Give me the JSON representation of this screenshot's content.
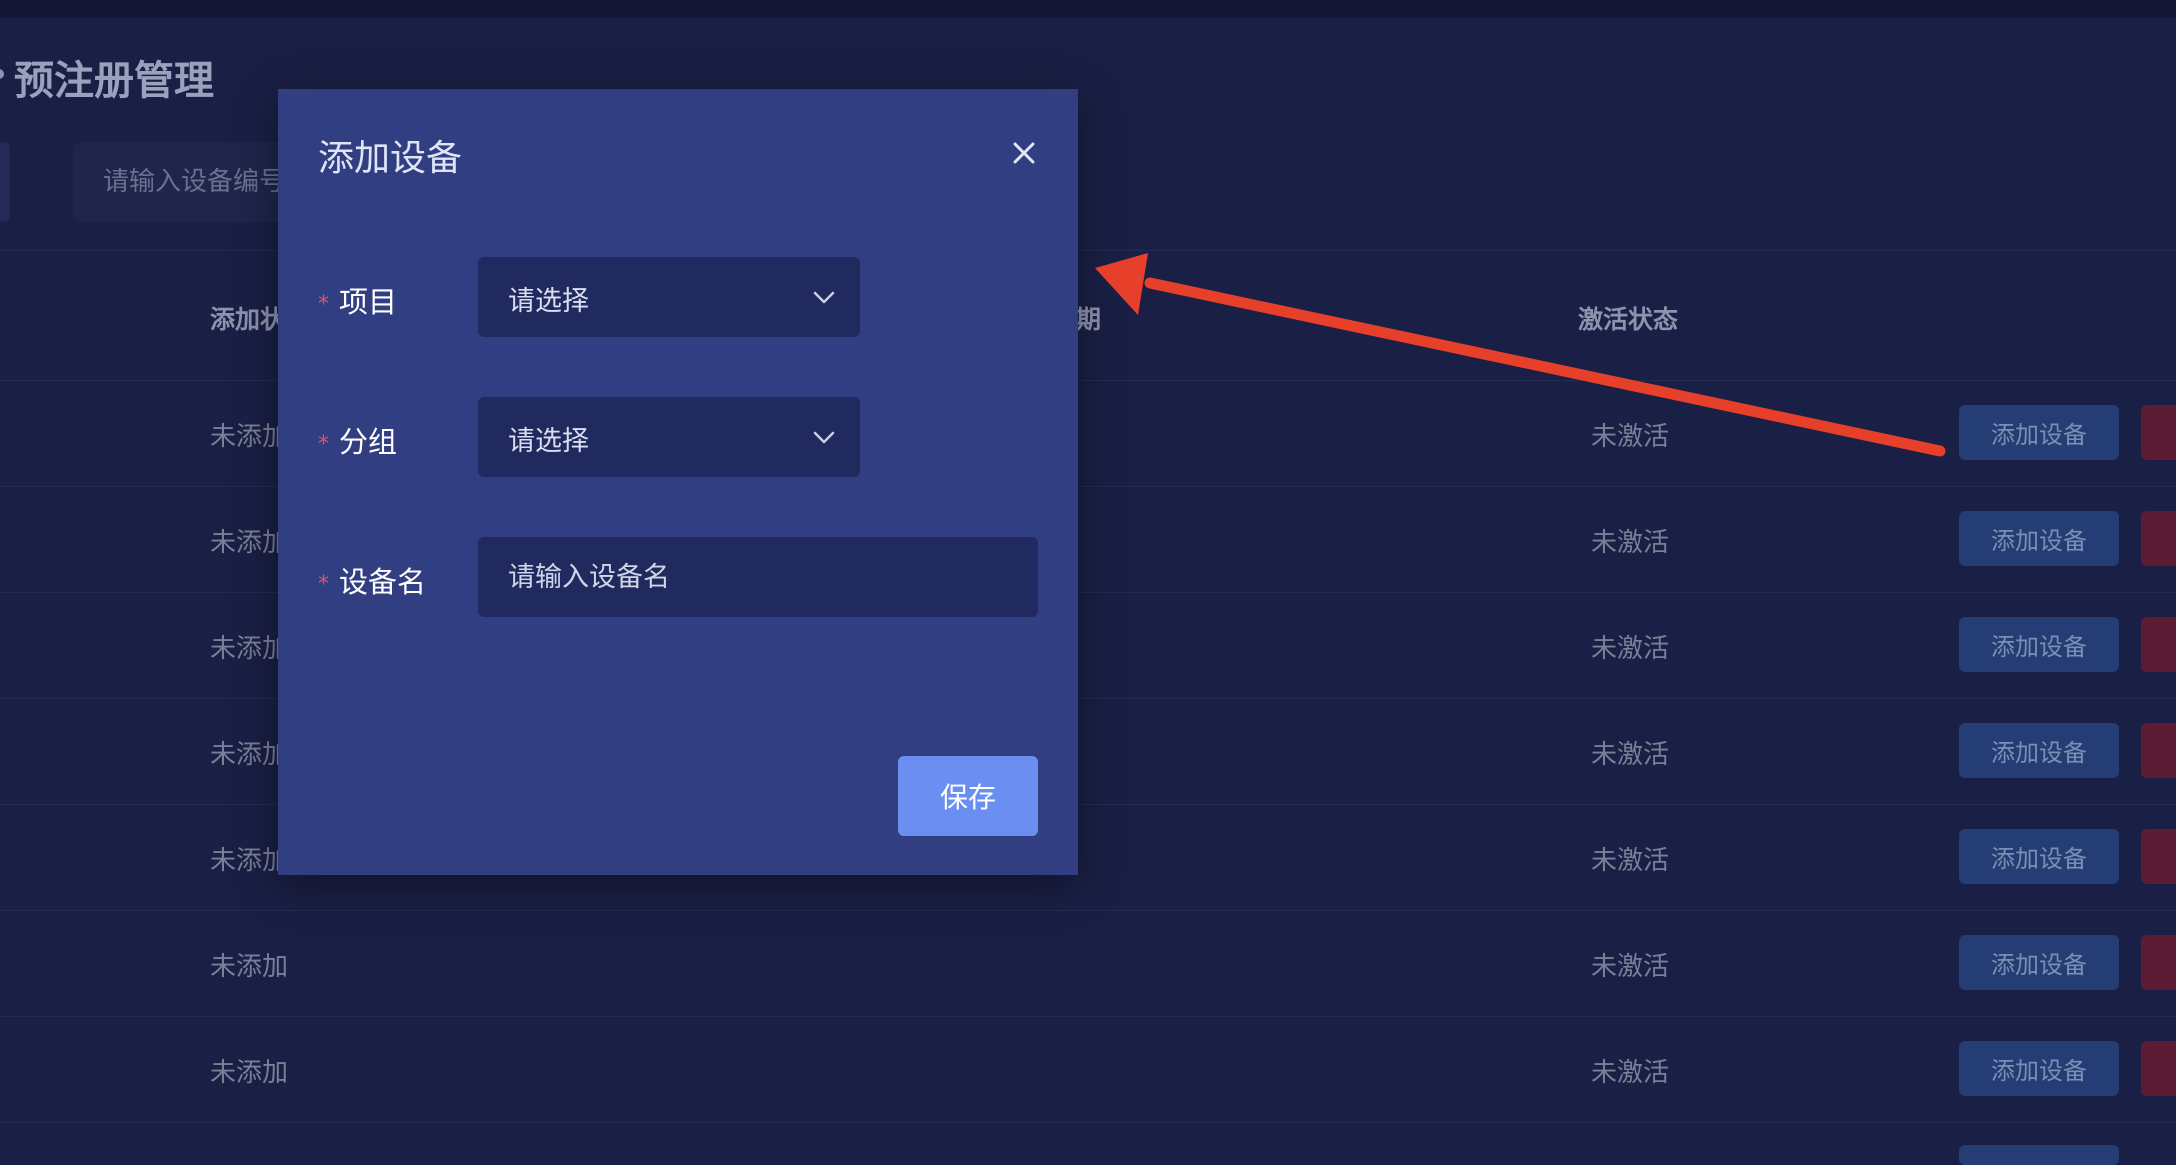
{
  "page": {
    "title": "预注册管理"
  },
  "search": {
    "placeholder": "请输入设备编号"
  },
  "table": {
    "headers": {
      "add_status": "添加状态",
      "date": "日期",
      "activation": "激活状态"
    },
    "rows": [
      {
        "add_status": "未添加",
        "activation": "未激活",
        "action": "添加设备"
      },
      {
        "add_status": "未添加",
        "activation": "未激活",
        "action": "添加设备"
      },
      {
        "add_status": "未添加",
        "activation": "未激活",
        "action": "添加设备"
      },
      {
        "add_status": "未添加",
        "activation": "未激活",
        "action": "添加设备"
      },
      {
        "add_status": "未添加",
        "activation": "未激活",
        "action": "添加设备"
      },
      {
        "add_status": "未添加",
        "activation": "未激活",
        "action": "添加设备"
      },
      {
        "add_status": "未添加",
        "activation": "未激活",
        "action": "添加设备"
      }
    ]
  },
  "modal": {
    "title": "添加设备",
    "fields": {
      "project": {
        "label": "项目",
        "value": "请选择"
      },
      "group": {
        "label": "分组",
        "value": "请选择"
      },
      "device_name": {
        "label": "设备名",
        "placeholder": "请输入设备名"
      }
    },
    "required_mark": "*",
    "save_label": "保存"
  },
  "icons": {
    "close": "close-icon",
    "chevron": "chevron-down-icon"
  },
  "colors": {
    "background": "#1a1f45",
    "modal": "#323e82",
    "primary": "#6a8ff0",
    "annotation_arrow": "#e63f2a",
    "danger": "#5c1d34"
  }
}
